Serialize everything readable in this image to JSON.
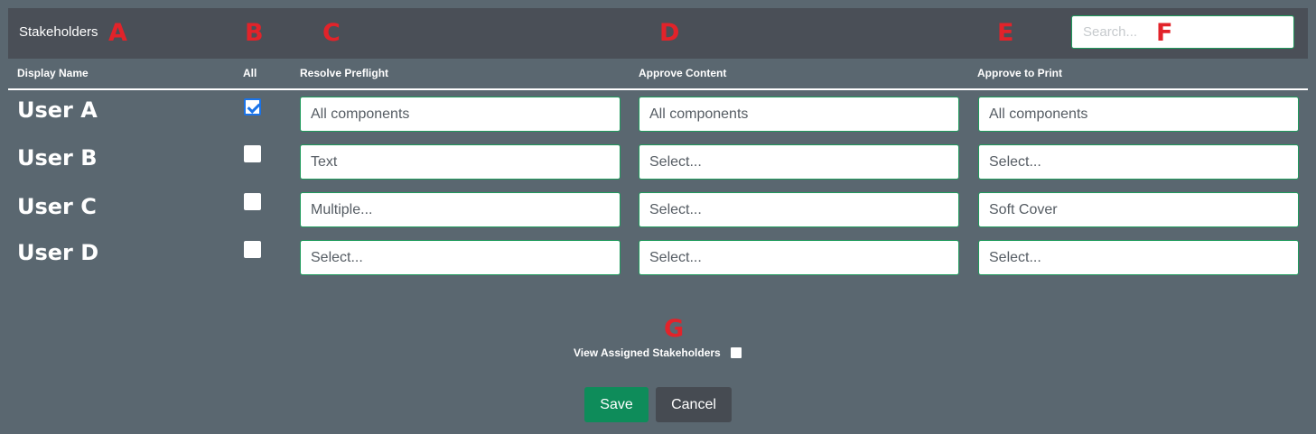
{
  "header": {
    "title": "Stakeholders",
    "search_placeholder": "Search..."
  },
  "annotations": {
    "a": "A",
    "b": "B",
    "c": "C",
    "d": "D",
    "e": "E",
    "f": "F",
    "g": "G"
  },
  "columns": {
    "display_name": "Display Name",
    "all": "All",
    "resolve_preflight": "Resolve Preflight",
    "approve_content": "Approve Content",
    "approve_to_print": "Approve to Print"
  },
  "rows": [
    {
      "name": "User A",
      "all_checked": true,
      "resolve_preflight": "All components",
      "approve_content": "All components",
      "approve_to_print": "All components"
    },
    {
      "name": "User B",
      "all_checked": false,
      "resolve_preflight": "Text",
      "approve_content": "Select...",
      "approve_to_print": "Select..."
    },
    {
      "name": "User C",
      "all_checked": false,
      "resolve_preflight": "Multiple...",
      "approve_content": "Select...",
      "approve_to_print": "Soft Cover"
    },
    {
      "name": "User D",
      "all_checked": false,
      "resolve_preflight": "Select...",
      "approve_content": "Select...",
      "approve_to_print": "Select..."
    }
  ],
  "footer": {
    "view_assigned_label": "View Assigned Stakeholders",
    "view_assigned_checked": false,
    "save_label": "Save",
    "cancel_label": "Cancel"
  },
  "colors": {
    "background": "#5a6770",
    "header_bar": "#4a4f57",
    "accent_green": "#0e8c5a",
    "field_border": "#1f9a5c",
    "annotation_red": "#e2232a",
    "cancel_button": "#464b52"
  }
}
